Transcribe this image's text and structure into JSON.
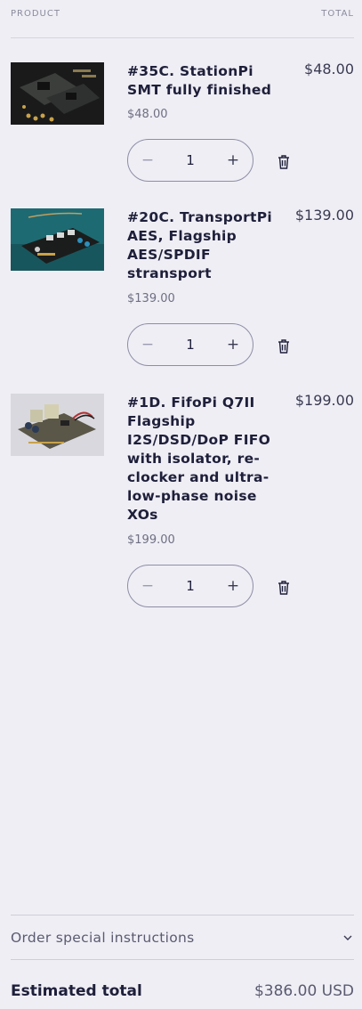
{
  "header": {
    "product_label": "PRODUCT",
    "total_label": "TOTAL"
  },
  "items": [
    {
      "title": "#35C. StationPi SMT fully finished",
      "unit_price": "$48.00",
      "line_total": "$48.00",
      "quantity": "1",
      "image": "stationpi-board-kit"
    },
    {
      "title": "#20C. TransportPi AES, Flagship AES/SPDIF stransport",
      "unit_price": "$139.00",
      "line_total": "$139.00",
      "quantity": "1",
      "image": "transportpi-board"
    },
    {
      "title": "#1D. FifoPi Q7II Flagship I2S/DSD/DoP FIFO with isolator, re-clocker and ultra-low-phase noise XOs",
      "unit_price": "$199.00",
      "line_total": "$199.00",
      "quantity": "1",
      "image": "fifopi-board"
    }
  ],
  "controls": {
    "minus": "−",
    "plus": "+"
  },
  "icons": {
    "remove": "trash-icon",
    "expand": "chevron-down-icon"
  },
  "instructions": {
    "label": "Order special instructions"
  },
  "summary": {
    "label": "Estimated total",
    "value": "$386.00 USD"
  }
}
